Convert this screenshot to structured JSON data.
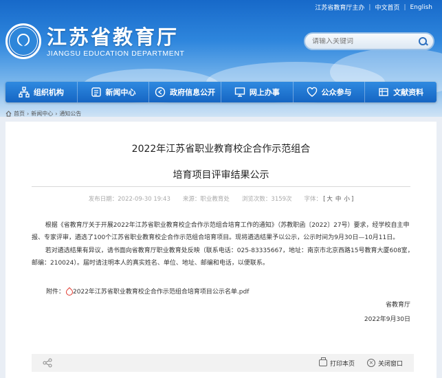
{
  "header": {
    "top_links": {
      "host": "江苏省教育厅主办",
      "chinese": "中文首页",
      "english": "English"
    },
    "logo_cn": "江苏省教育厅",
    "logo_en": "JIANGSU EDUCATION DEPARTMENT"
  },
  "search": {
    "placeholder": "请输入关键词"
  },
  "nav": {
    "items": [
      {
        "label": "组织机构",
        "icon": "org-chart-icon"
      },
      {
        "label": "新闻中心",
        "icon": "news-icon"
      },
      {
        "label": "政府信息公开",
        "icon": "info-open-icon"
      },
      {
        "label": "网上办事",
        "icon": "monitor-icon"
      },
      {
        "label": "公众参与",
        "icon": "heart-icon"
      },
      {
        "label": "文献资料",
        "icon": "library-icon"
      }
    ]
  },
  "breadcrumb": [
    "首页",
    "新闻中心",
    "通知公告"
  ],
  "article": {
    "title_line1": "2022年江苏省职业教育校企合作示范组合",
    "title_line2": "培育项目评审结果公示",
    "meta": {
      "date_label": "发布日期：",
      "date": "2022-09-30 19:43",
      "source_label": "来源：",
      "source": "职业教育处",
      "views_label": "浏览次数：",
      "views": "3159次",
      "font_label": "字体：",
      "font_large": "大",
      "font_medium": "中",
      "font_small": "小"
    },
    "para1": "根据《省教育厅关于开展2022年江苏省职业教育校企合作示范组合培育工作的通知》（苏教职函〔2022〕27号）要求，经学校自主申报、专家评审，遴选了100个江苏省职业教育校企合作示范组合培育项目。现将遴选结果予以公示，公示时间为9月30日—10月11日。",
    "para2": "若对遴选结果有异议，请书面向省教育厅职业教育处反映（联系电话：025-83335667，地址：南京市北京西路15号教育大厦608室，邮编：210024）。届时请注明本人的真实姓名、单位、地址、邮编和电话，以便联系。",
    "attachment_label": "附件：",
    "attachment_file": "2022年江苏省职业教育校企合作示范组合培育项目公示名单.pdf",
    "signature_org": "省教育厅",
    "signature_date": "2022年9月30日"
  },
  "footer": {
    "print": "打印本页",
    "close": "关闭窗口"
  },
  "colors": {
    "nav_blue": "#1565c3",
    "header_blue": "#1769c9",
    "pdf_red": "#e0362b"
  }
}
